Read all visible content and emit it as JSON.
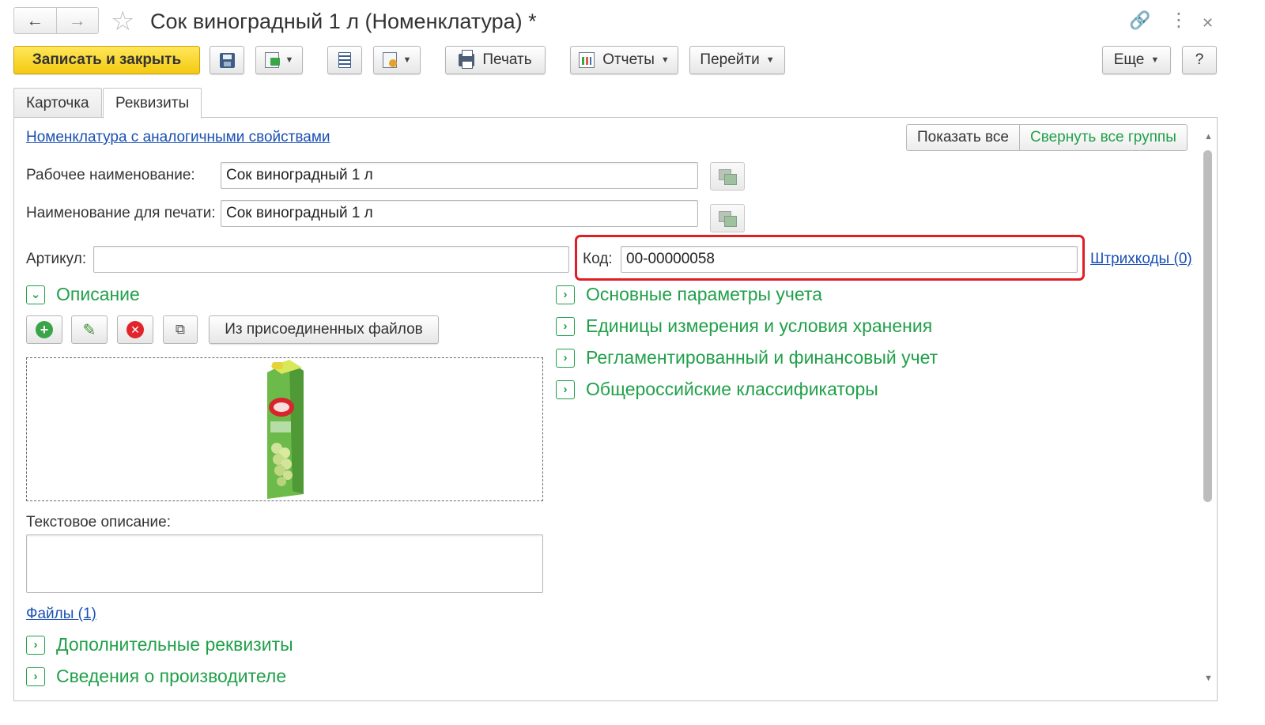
{
  "window": {
    "title": "Сок виноградный 1 л (Номенклатура) *",
    "back_icon": "←",
    "forward_icon": "→",
    "star_icon": "☆",
    "link_icon": "🔗",
    "more_icon": "⋮",
    "close_icon": "✕"
  },
  "toolbar": {
    "save_close_label": "Записать и закрыть",
    "print_label": "Печать",
    "reports_label": "Отчеты",
    "goto_label": "Перейти",
    "more_label": "Еще",
    "help_label": "?"
  },
  "tabs": [
    {
      "label": "Карточка",
      "active": false
    },
    {
      "label": "Реквизиты",
      "active": true
    }
  ],
  "form": {
    "similar_link": "Номенклатура с аналогичными свойствами",
    "show_all_label": "Показать все",
    "collapse_all_label": "Свернуть все группы",
    "working_name_label": "Рабочее наименование:",
    "working_name_value": "Сок виноградный 1 л",
    "print_name_label": "Наименование для печати:",
    "print_name_value": "Сок виноградный 1 л",
    "article_label": "Артикул:",
    "article_value": "",
    "code_label": "Код:",
    "code_value": "00-00000058",
    "barcodes_link": "Штрихкоды (0)",
    "description_group": "Описание",
    "from_files_label": "Из присоединенных файлов",
    "text_description_label": "Текстовое описание:",
    "files_link": "Файлы (1)",
    "additional_group": "Дополнительные реквизиты",
    "manufacturer_group": "Сведения о производителе"
  },
  "right_groups": [
    "Основные параметры учета",
    "Единицы измерения и условия хранения",
    "Регламентированный и финансовый учет",
    "Общероссийские классификаторы"
  ],
  "colors": {
    "accent_yellow": "#f4c911",
    "group_green": "#21a04a",
    "link_blue": "#1a4fb4",
    "highlight_red": "#e01e24"
  }
}
